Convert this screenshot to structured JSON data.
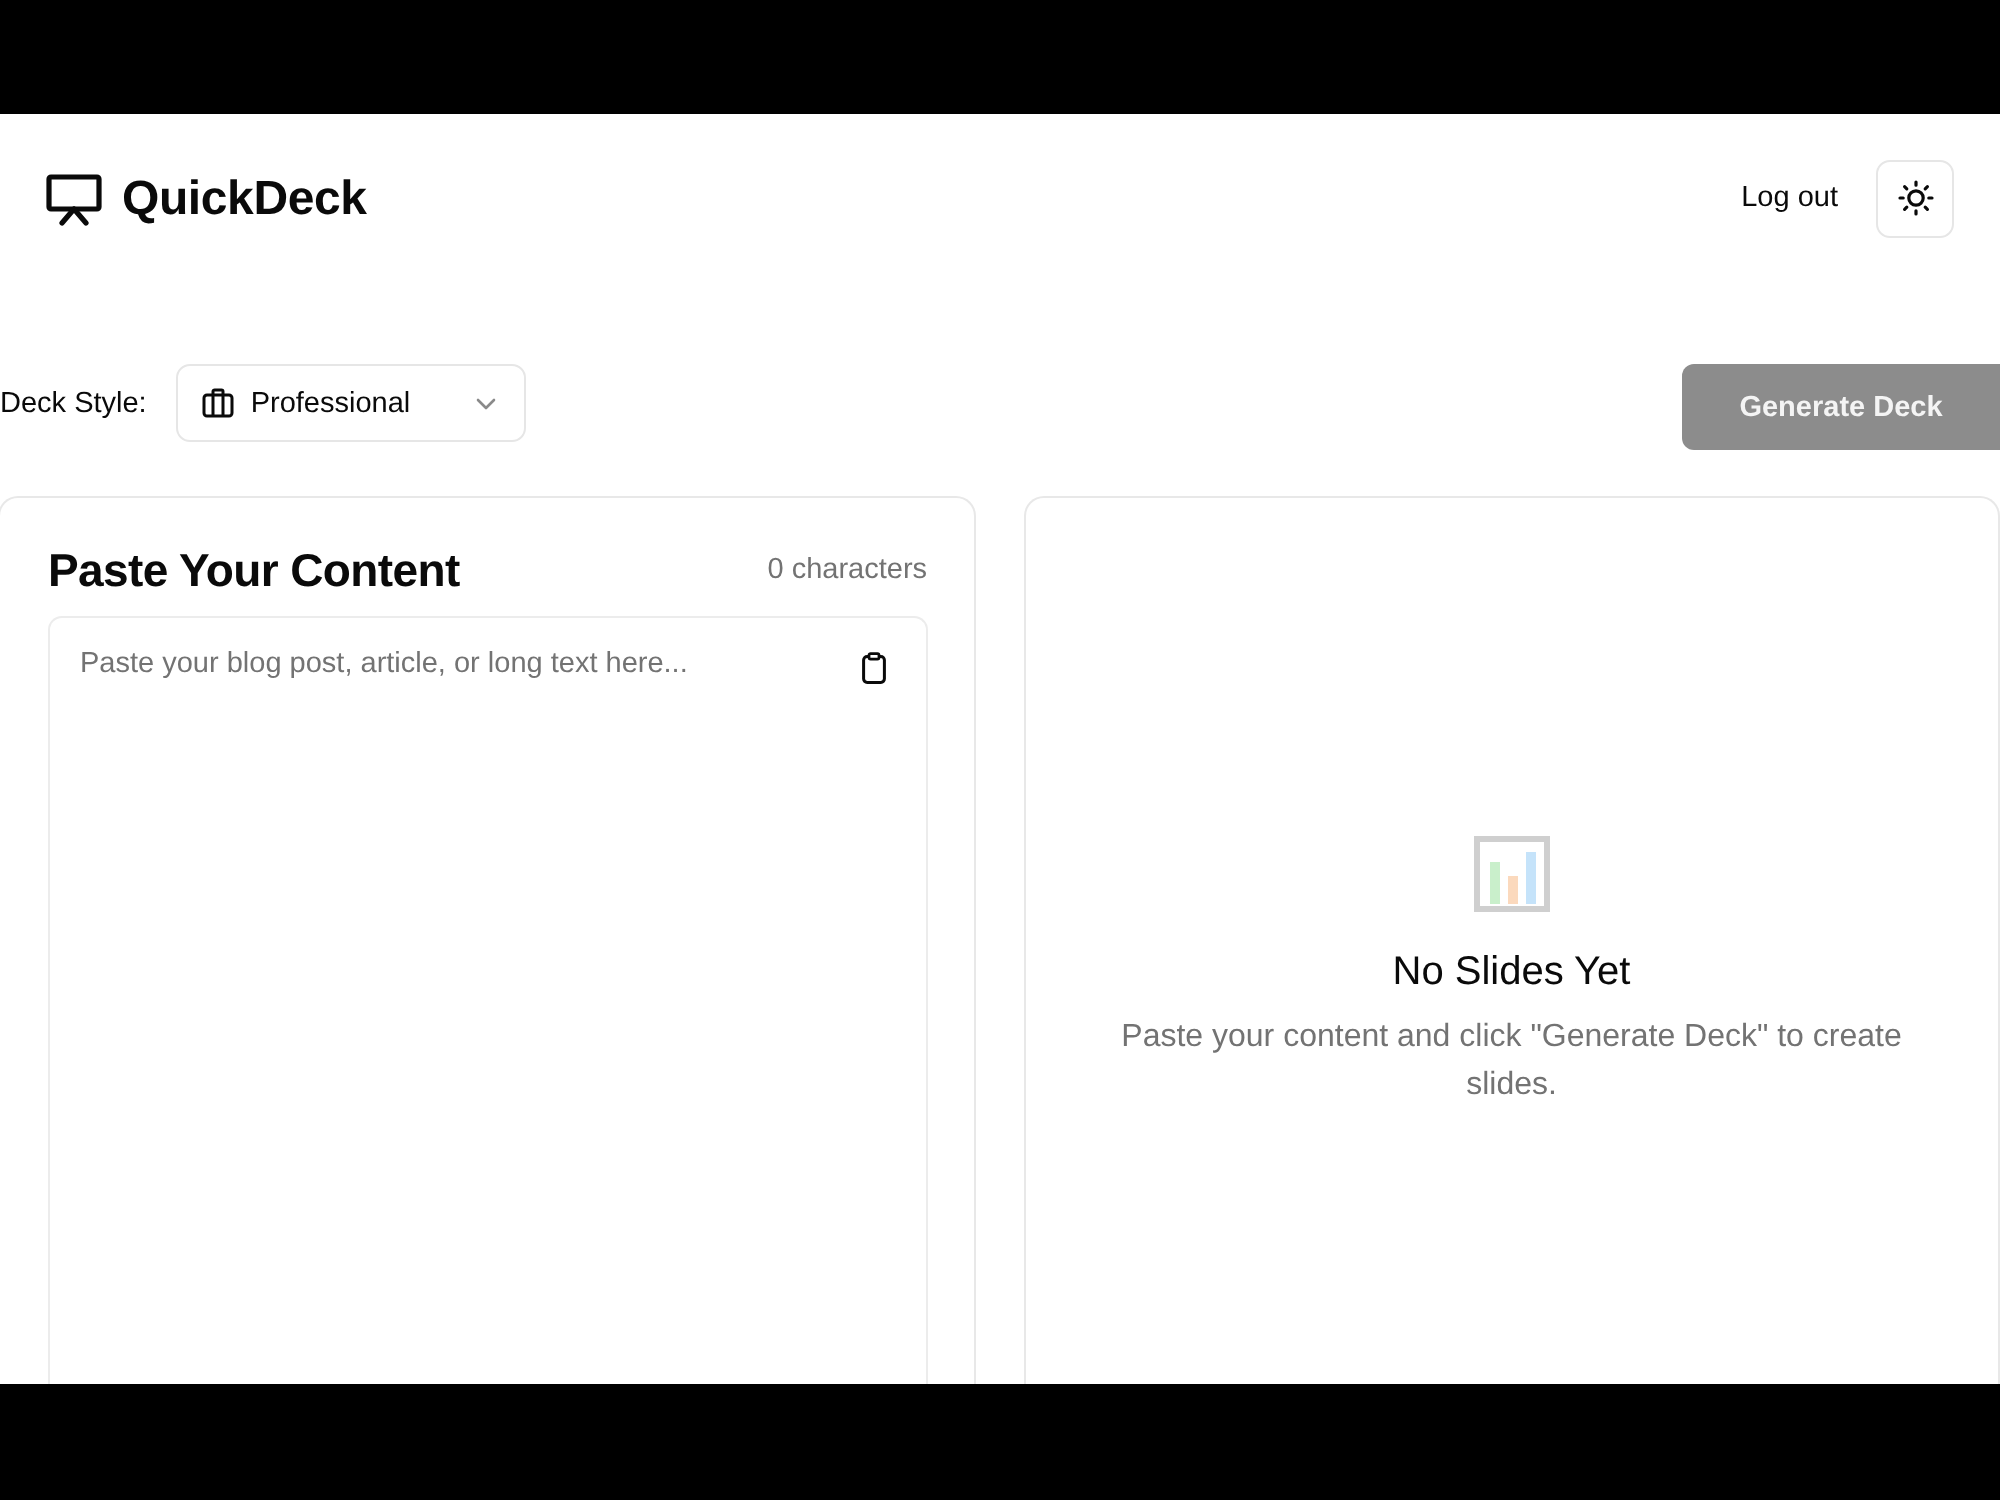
{
  "header": {
    "brand": "QuickDeck",
    "logout_label": "Log out"
  },
  "toolbar": {
    "style_label": "Deck Style:",
    "style_select": {
      "value": "Professional"
    },
    "generate_button": {
      "label": "Generate Deck",
      "disabled": true
    }
  },
  "content_panel": {
    "title": "Paste Your Content",
    "char_count": "0 characters",
    "textarea": {
      "placeholder": "Paste your blog post, article, or long text here..."
    }
  },
  "preview_panel": {
    "empty_title": "No Slides Yet",
    "empty_text": "Paste your content and click \"Generate Deck\" to create slides."
  }
}
